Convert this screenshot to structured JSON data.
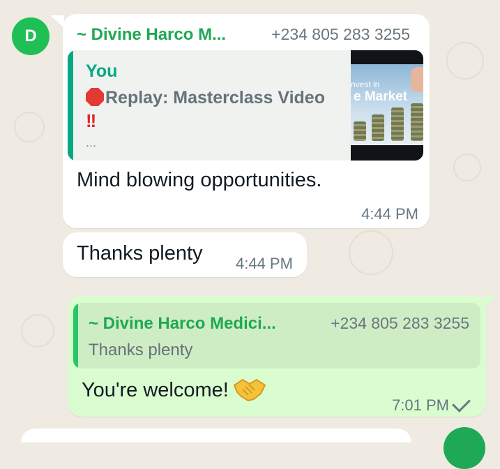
{
  "avatar": {
    "initial": "D",
    "color": "#1fbf55"
  },
  "incoming1": {
    "sender_name": "~ Divine Harco M...",
    "sender_phone": "+234 805 283 3255",
    "quote": {
      "author": "You",
      "text": "Replay: Masterclass Video",
      "more": "...",
      "thumb_kicker": "nvest in",
      "thumb_title": "e Market"
    },
    "body": "Mind blowing opportunities.",
    "time": "4:44 PM"
  },
  "incoming2": {
    "body": "Thanks plenty",
    "time": "4:44 PM"
  },
  "outgoing": {
    "quote": {
      "author": "~ Divine Harco Medici...",
      "phone": "+234 805 283 3255",
      "text": "Thanks plenty"
    },
    "body": "You're welcome!",
    "time": "7:01 PM",
    "status_icon": "single-check-icon"
  },
  "colors": {
    "accent_green": "#1fa855",
    "bubble_out": "#dafdd0",
    "bubble_in": "#ffffff",
    "wallpaper": "#efeae2"
  }
}
